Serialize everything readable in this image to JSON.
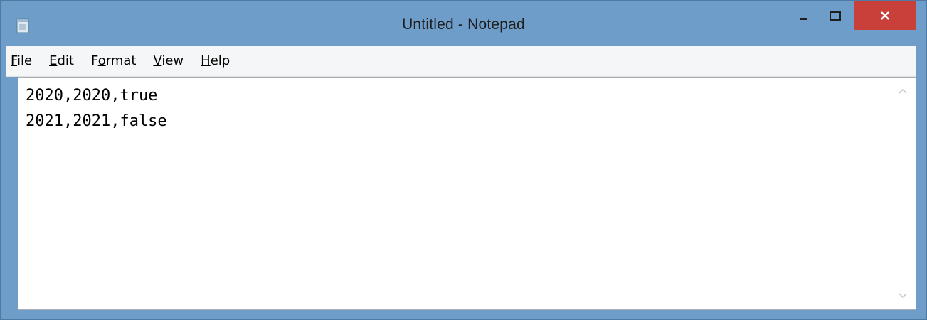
{
  "window": {
    "title": "Untitled - Notepad",
    "app_icon": "notepad-icon",
    "controls": {
      "minimize": "minimize-icon",
      "maximize": "maximize-icon",
      "close": "close-icon"
    },
    "colors": {
      "frame": "#6f9dc9",
      "close_button": "#c9403a",
      "menu_background": "#f5f6f7",
      "editor_background": "#ffffff"
    }
  },
  "menu": {
    "items": [
      {
        "accel": "F",
        "rest": "ile"
      },
      {
        "accel": "E",
        "rest": "dit"
      },
      {
        "pre": "F",
        "accel": "o",
        "rest": "rmat"
      },
      {
        "accel": "V",
        "rest": "iew"
      },
      {
        "accel": "H",
        "rest": "elp"
      }
    ]
  },
  "editor": {
    "content": "2020,2020,true\n2021,2021,false"
  }
}
